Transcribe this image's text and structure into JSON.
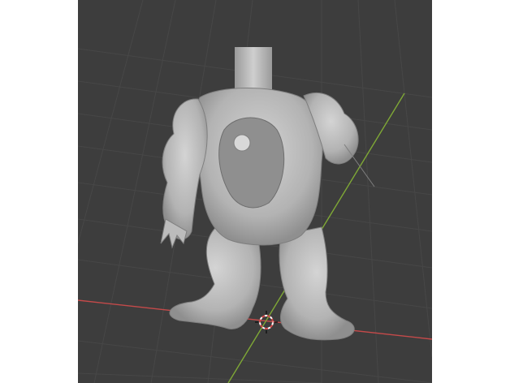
{
  "viewport": {
    "background": "#3d3d3d",
    "grid_color": "#4a4a4a",
    "x_axis_color": "#c44a4a",
    "y_axis_color": "#7fa836",
    "model_color": "#bdbdbd",
    "model_shadow": "#8e8e8e"
  },
  "icons": {
    "origin": "3d-cursor-icon"
  }
}
